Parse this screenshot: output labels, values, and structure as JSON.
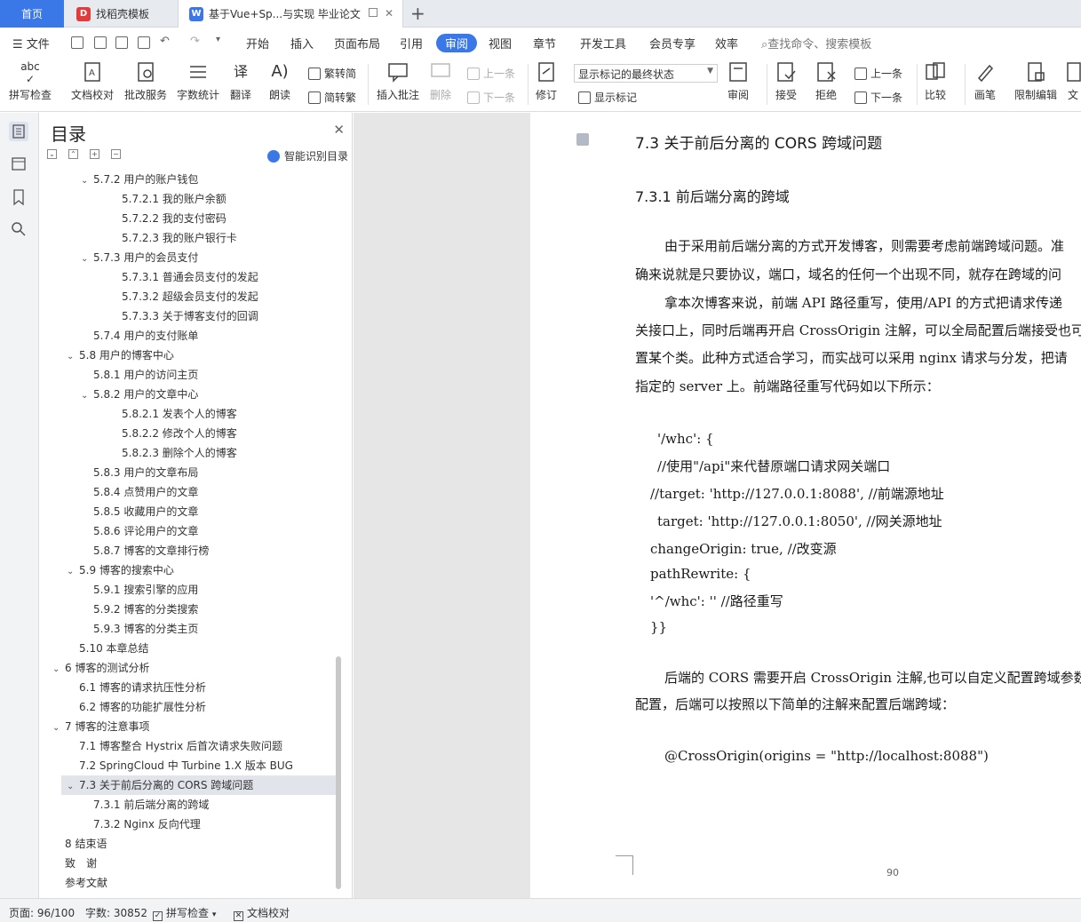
{
  "tabs": {
    "home": "首页",
    "template": "找稻壳模板",
    "document": "基于Vue+Sp...与实现 毕业论文"
  },
  "menu": {
    "file": "文件",
    "items": [
      "开始",
      "插入",
      "页面布局",
      "引用",
      "审阅",
      "视图",
      "章节",
      "开发工具",
      "会员专享",
      "效率"
    ],
    "active": "审阅",
    "search": "查找命令、搜索模板"
  },
  "ribbon": {
    "spell_check": "拼写检查",
    "doc_proof": "文档校对",
    "batch_service": "批改服务",
    "word_count": "字数统计",
    "translate": "翻译",
    "read_aloud": "朗读",
    "to_traditional": "繁转简",
    "to_simplified": "简转繁",
    "insert_comment": "插入批注",
    "delete": "删除",
    "prev_comment": "上一条",
    "next_comment": "下一条",
    "revise": "修订",
    "markup_mode": "显示标记的最终状态",
    "show_markup": "显示标记",
    "review": "审阅",
    "accept": "接受",
    "reject": "拒绝",
    "prev_change": "上一条",
    "next_change": "下一条",
    "compare": "比较",
    "pen": "画笔",
    "restrict_edit": "限制编辑",
    "doc_rights": "文"
  },
  "toc": {
    "title": "目录",
    "smart": "智能识别目录",
    "items": [
      {
        "text": "5.7.2 用户的账户钱包",
        "level": 3,
        "chev": "v",
        "selected": false
      },
      {
        "text": "5.7.2.1 我的账户余额",
        "level": 4,
        "chev": "",
        "selected": false
      },
      {
        "text": "5.7.2.2 我的支付密码",
        "level": 4,
        "chev": "",
        "selected": false
      },
      {
        "text": "5.7.2.3 我的账户银行卡",
        "level": 4,
        "chev": "",
        "selected": false
      },
      {
        "text": "5.7.3 用户的会员支付",
        "level": 3,
        "chev": "v",
        "selected": false
      },
      {
        "text": "5.7.3.1 普通会员支付的发起",
        "level": 4,
        "chev": "",
        "selected": false
      },
      {
        "text": "5.7.3.2 超级会员支付的发起",
        "level": 4,
        "chev": "",
        "selected": false
      },
      {
        "text": "5.7.3.3 关于博客支付的回调",
        "level": 4,
        "chev": "",
        "selected": false
      },
      {
        "text": "5.7.4 用户的支付账单",
        "level": 3,
        "chev": "",
        "selected": false
      },
      {
        "text": "5.8 用户的博客中心",
        "level": 2,
        "chev": "v",
        "selected": false
      },
      {
        "text": "5.8.1 用户的访问主页",
        "level": 3,
        "chev": "",
        "selected": false
      },
      {
        "text": "5.8.2 用户的文章中心",
        "level": 3,
        "chev": "v",
        "selected": false
      },
      {
        "text": "5.8.2.1 发表个人的博客",
        "level": 4,
        "chev": "",
        "selected": false
      },
      {
        "text": "5.8.2.2 修改个人的博客",
        "level": 4,
        "chev": "",
        "selected": false
      },
      {
        "text": "5.8.2.3 删除个人的博客",
        "level": 4,
        "chev": "",
        "selected": false
      },
      {
        "text": "5.8.3 用户的文章布局",
        "level": 3,
        "chev": "",
        "selected": false
      },
      {
        "text": "5.8.4 点赞用户的文章",
        "level": 3,
        "chev": "",
        "selected": false
      },
      {
        "text": "5.8.5 收藏用户的文章",
        "level": 3,
        "chev": "",
        "selected": false
      },
      {
        "text": "5.8.6 评论用户的文章",
        "level": 3,
        "chev": "",
        "selected": false
      },
      {
        "text": "5.8.7 博客的文章排行榜",
        "level": 3,
        "chev": "",
        "selected": false
      },
      {
        "text": "5.9 博客的搜索中心",
        "level": 2,
        "chev": "v",
        "selected": false
      },
      {
        "text": "5.9.1 搜索引擎的应用",
        "level": 3,
        "chev": "",
        "selected": false
      },
      {
        "text": "5.9.2 博客的分类搜索",
        "level": 3,
        "chev": "",
        "selected": false
      },
      {
        "text": "5.9.3 博客的分类主页",
        "level": 3,
        "chev": "",
        "selected": false
      },
      {
        "text": "5.10 本章总结",
        "level": 2,
        "chev": "",
        "selected": false
      },
      {
        "text": "6 博客的测试分析",
        "level": 1,
        "chev": "v",
        "selected": false
      },
      {
        "text": "6.1 博客的请求抗压性分析",
        "level": 2,
        "chev": "",
        "selected": false
      },
      {
        "text": "6.2 博客的功能扩展性分析",
        "level": 2,
        "chev": "",
        "selected": false
      },
      {
        "text": "7 博客的注意事项",
        "level": 1,
        "chev": "v",
        "selected": false
      },
      {
        "text": "7.1 博客整合 Hystrix 后首次请求失败问题",
        "level": 2,
        "chev": "",
        "selected": false
      },
      {
        "text": "7.2 SpringCloud 中 Turbine 1.X 版本 BUG",
        "level": 2,
        "chev": "",
        "selected": false
      },
      {
        "text": "7.3 关于前后分离的 CORS 跨域问题",
        "level": 2,
        "chev": "v",
        "selected": true
      },
      {
        "text": "7.3.1 前后端分离的跨域",
        "level": 3,
        "chev": "",
        "selected": false
      },
      {
        "text": "7.3.2 Nginx 反向代理",
        "level": 3,
        "chev": "",
        "selected": false
      },
      {
        "text": "8 结束语",
        "level": 1,
        "chev": "",
        "selected": false
      },
      {
        "text": "致　谢",
        "level": 1,
        "chev": "",
        "selected": false
      },
      {
        "text": "参考文献",
        "level": 1,
        "chev": "",
        "selected": false
      }
    ]
  },
  "doc": {
    "h2": "7.3 关于前后分离的 CORS 跨域问题",
    "h3": "7.3.1 前后端分离的跨域",
    "p1a": "由于采用前后端分离的方式开发博客，则需要考虑前端跨域问题。准",
    "p1b": "确来说就是只要协议，端口，域名的任何一个出现不同，就存在跨域的问",
    "p2a": "拿本次博客来说，前端 API 路径重写，使用/API 的方式把请求传递",
    "p2b": "关接口上，同时后端再开启 CrossOrigin 注解，可以全局配置后端接受也可",
    "p2c": "置某个类。此种方式适合学习，而实战可以采用 nginx 请求与分发，把请",
    "p2d": "指定的 server 上。前端路径重写代码如以下所示：",
    "code1": "'/whc': {",
    "code2": "//使用\"/api\"来代替原端口请求网关端口",
    "code3": "//target: 'http://127.0.0.1:8088', //前端源地址",
    "code4": "target: 'http://127.0.0.1:8050', //网关源地址",
    "code5": "changeOrigin: true, //改变源",
    "code6": "pathRewrite: {",
    "code7": "'^/whc': '' //路径重写",
    "code8": "}}",
    "p3a": "后端的 CORS 需要开启 CrossOrigin 注解,也可以自定义配置跨域参数",
    "p3b": "配置，后端可以按照以下简单的注解来配置后端跨域：",
    "annotation": "@CrossOrigin(origins = \"http://localhost:8088\")",
    "page_number": "90"
  },
  "status": {
    "page": "页面: 96/100",
    "words": "字数: 30852",
    "spell": "拼写检查",
    "proof": "文档校对"
  },
  "colors": {
    "accent": "#3b78e7",
    "selected_row": "#e1e4ea"
  }
}
